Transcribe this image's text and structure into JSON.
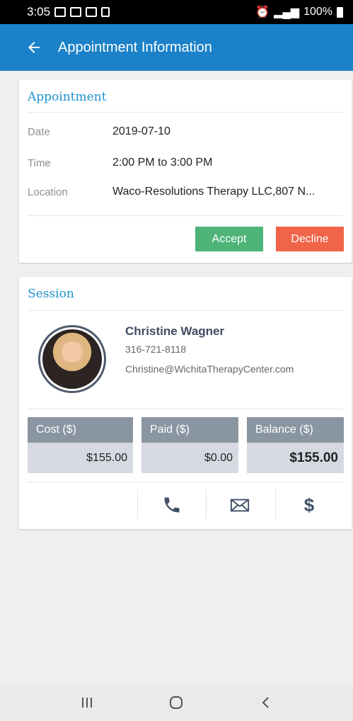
{
  "status_bar": {
    "time": "3:05",
    "battery": "100%"
  },
  "app_bar": {
    "title": "Appointment Information"
  },
  "appointment": {
    "section_title": "Appointment",
    "rows": [
      {
        "label": "Date",
        "value": "2019-07-10"
      },
      {
        "label": "Time",
        "value": "2:00 PM to 3:00 PM"
      },
      {
        "label": "Location",
        "value": "Waco-Resolutions Therapy LLC,807 N..."
      }
    ],
    "accept_label": "Accept",
    "decline_label": "Decline"
  },
  "session": {
    "section_title": "Session",
    "contact": {
      "name": "Christine Wagner",
      "phone": "316-721-8118",
      "email": "Christine@WichitaTherapyCenter.com"
    },
    "cost": {
      "label": "Cost ($)",
      "value": "$155.00"
    },
    "paid": {
      "label": "Paid ($)",
      "value": "$0.00"
    },
    "balance": {
      "label": "Balance ($)",
      "value": "$155.00"
    }
  },
  "icons": {
    "back": "arrow-left-icon",
    "call": "phone-icon",
    "email": "envelope-icon",
    "payment": "dollar-icon"
  },
  "colors": {
    "app_bar": "#1b82c9",
    "section_title": "#1f93cc",
    "accept": "#4fb477",
    "decline": "#f06449",
    "money_header": "#8a95a2",
    "money_value": "#d6d9e1",
    "action_icon": "#3f4f66"
  }
}
